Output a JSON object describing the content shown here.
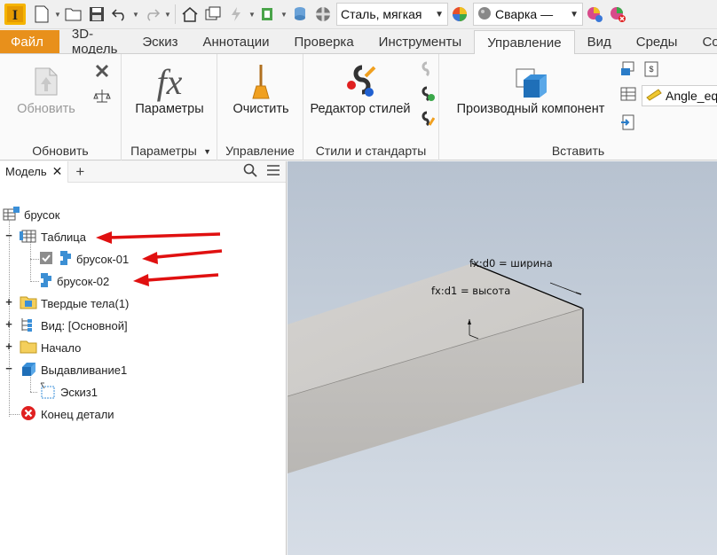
{
  "qat": {
    "material": "Сталь, мягкая",
    "appearance": "Сварка —"
  },
  "tabs": [
    {
      "label": "Файл"
    },
    {
      "label": "3D-модель"
    },
    {
      "label": "Эскиз"
    },
    {
      "label": "Аннотации"
    },
    {
      "label": "Проверка"
    },
    {
      "label": "Инструменты"
    },
    {
      "label": "Управление"
    },
    {
      "label": "Вид"
    },
    {
      "label": "Среды"
    },
    {
      "label": "Сов"
    }
  ],
  "ribbon": {
    "update_btn": "Обновить",
    "update_panel": "Обновить",
    "params_btn": "Параметры",
    "params_panel": "Параметры",
    "purge_btn": "Очистить",
    "manage_panel": "Управление",
    "style_editor_btn": "Редактор стилей",
    "styles_panel": "Стили и стандарты",
    "derived_btn": "Производный компонент",
    "insert_panel": "Вставить",
    "angle_field": "Angle_eq"
  },
  "browser": {
    "tab_label": "Модель",
    "nodes": [
      {
        "label": "брусок"
      },
      {
        "label": "Таблица"
      },
      {
        "label": "брусок-01"
      },
      {
        "label": "брусок-02"
      },
      {
        "label": "Твердые тела(1)"
      },
      {
        "label": "Вид: [Основной]"
      },
      {
        "label": "Начало"
      },
      {
        "label": "Выдавливание1"
      },
      {
        "label": "Эскиз1"
      },
      {
        "label": "Конец детали"
      }
    ]
  },
  "viewport": {
    "dim_width": "fx:d0 = ширина",
    "dim_height": "fx:d1 = высота"
  },
  "colors": {
    "file_tab": "#e8901b",
    "arrow": "#e01010",
    "table_icon": "#3c8fd4"
  }
}
